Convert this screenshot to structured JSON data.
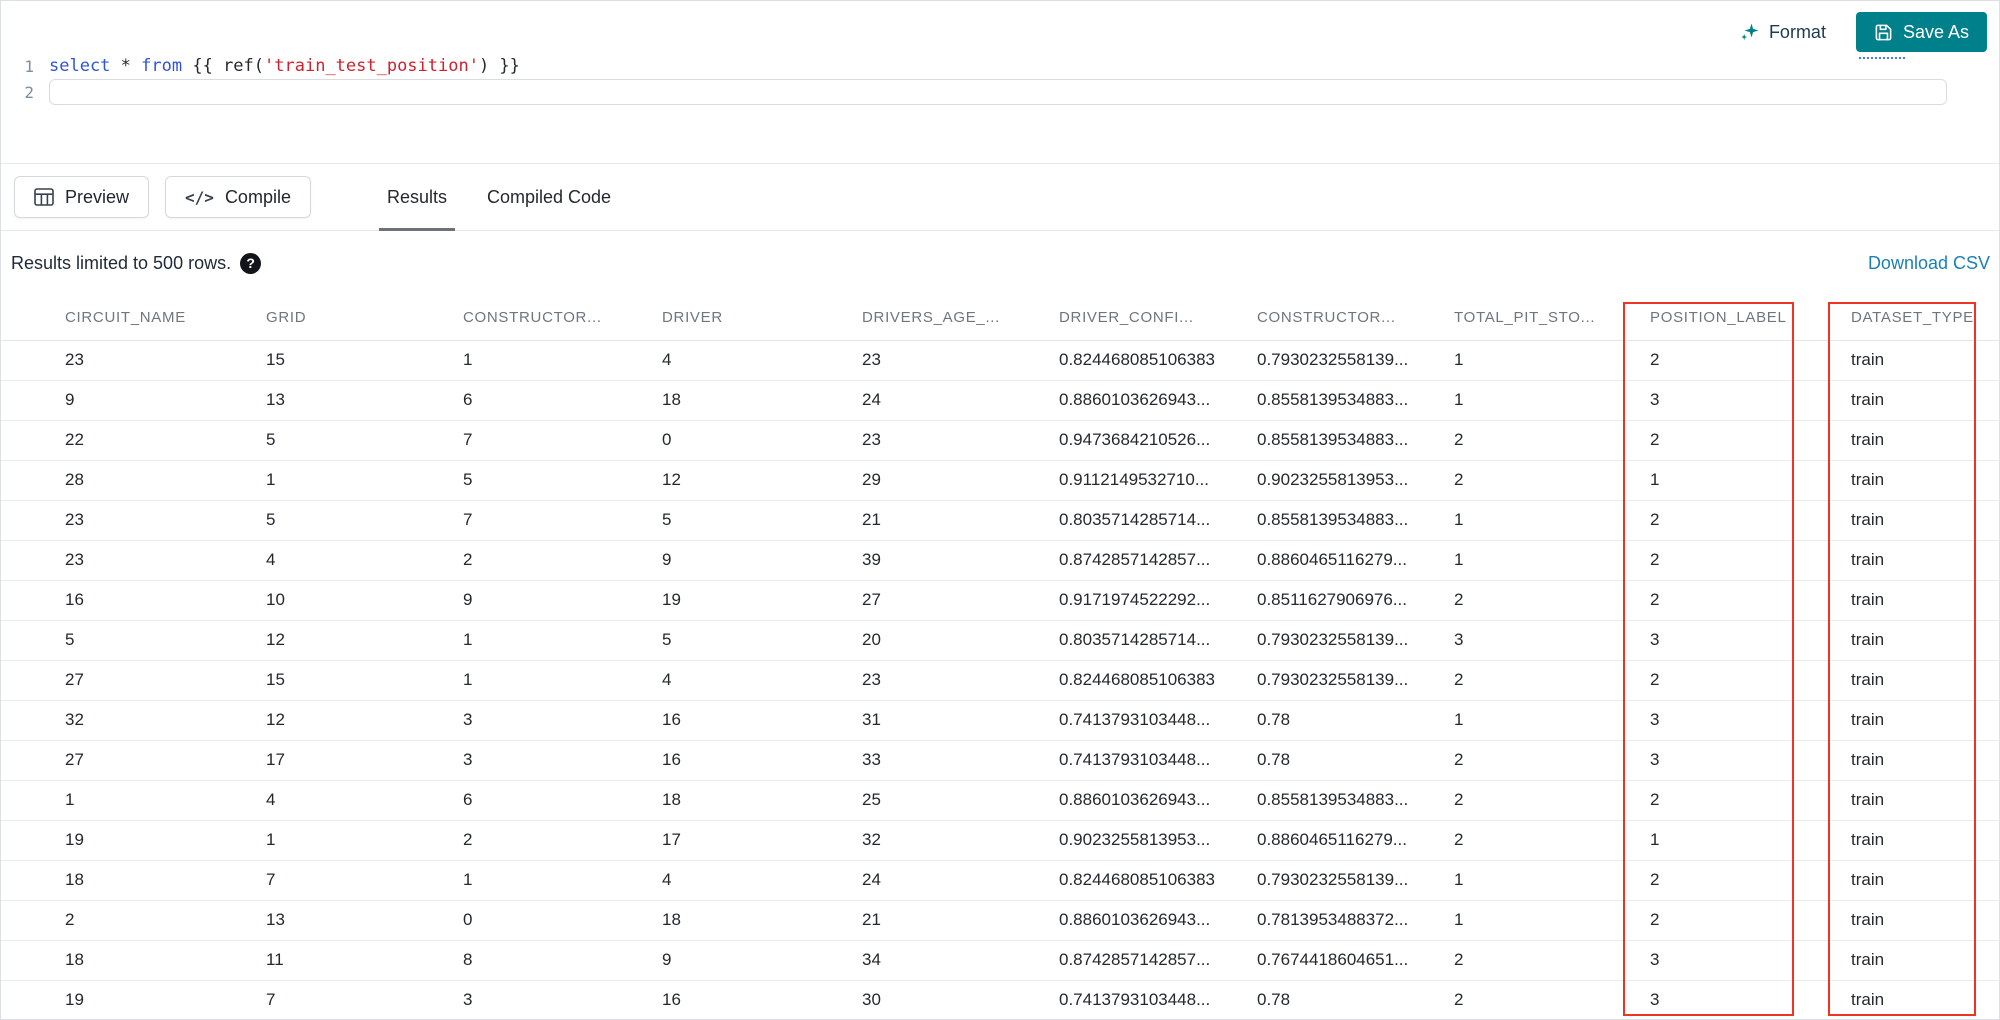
{
  "toolbar": {
    "format_label": "Format",
    "save_as_label": "Save As"
  },
  "editor": {
    "line_numbers": [
      "1",
      "2"
    ],
    "code_tokens": [
      {
        "t": "select",
        "c": "keyword"
      },
      {
        "t": " ",
        "c": "plain"
      },
      {
        "t": "*",
        "c": "operator"
      },
      {
        "t": " ",
        "c": "plain"
      },
      {
        "t": "from",
        "c": "keyword"
      },
      {
        "t": " {{ ref(",
        "c": "plain"
      },
      {
        "t": "'train_test_position'",
        "c": "string"
      },
      {
        "t": ") }}",
        "c": "plain"
      }
    ]
  },
  "actions": {
    "preview_label": "Preview",
    "compile_label": "Compile"
  },
  "tabs": [
    {
      "label": "Results",
      "active": true
    },
    {
      "label": "Compiled Code",
      "active": false
    }
  ],
  "results": {
    "limit_text": "Results limited to 500 rows.",
    "download_csv_label": "Download CSV"
  },
  "icons": {
    "compile_glyph": "</>",
    "help_glyph": "?"
  },
  "table": {
    "columns": [
      "CIRCUIT_NAME",
      "GRID",
      "CONSTRUCTOR...",
      "DRIVER",
      "DRIVERS_AGE_...",
      "DRIVER_CONFI...",
      "CONSTRUCTOR...",
      "TOTAL_PIT_STO...",
      "POSITION_LABEL",
      "DATASET_TYPE"
    ],
    "rows": [
      [
        "23",
        "15",
        "1",
        "4",
        "23",
        "0.824468085106383",
        "0.7930232558139...",
        "1",
        "2",
        "train"
      ],
      [
        "9",
        "13",
        "6",
        "18",
        "24",
        "0.8860103626943...",
        "0.8558139534883...",
        "1",
        "3",
        "train"
      ],
      [
        "22",
        "5",
        "7",
        "0",
        "23",
        "0.9473684210526...",
        "0.8558139534883...",
        "2",
        "2",
        "train"
      ],
      [
        "28",
        "1",
        "5",
        "12",
        "29",
        "0.9112149532710...",
        "0.9023255813953...",
        "2",
        "1",
        "train"
      ],
      [
        "23",
        "5",
        "7",
        "5",
        "21",
        "0.8035714285714...",
        "0.8558139534883...",
        "1",
        "2",
        "train"
      ],
      [
        "23",
        "4",
        "2",
        "9",
        "39",
        "0.8742857142857...",
        "0.8860465116279...",
        "1",
        "2",
        "train"
      ],
      [
        "16",
        "10",
        "9",
        "19",
        "27",
        "0.9171974522292...",
        "0.8511627906976...",
        "2",
        "2",
        "train"
      ],
      [
        "5",
        "12",
        "1",
        "5",
        "20",
        "0.8035714285714...",
        "0.7930232558139...",
        "3",
        "3",
        "train"
      ],
      [
        "27",
        "15",
        "1",
        "4",
        "23",
        "0.824468085106383",
        "0.7930232558139...",
        "2",
        "2",
        "train"
      ],
      [
        "32",
        "12",
        "3",
        "16",
        "31",
        "0.7413793103448...",
        "0.78",
        "1",
        "3",
        "train"
      ],
      [
        "27",
        "17",
        "3",
        "16",
        "33",
        "0.7413793103448...",
        "0.78",
        "2",
        "3",
        "train"
      ],
      [
        "1",
        "4",
        "6",
        "18",
        "25",
        "0.8860103626943...",
        "0.8558139534883...",
        "2",
        "2",
        "train"
      ],
      [
        "19",
        "1",
        "2",
        "17",
        "32",
        "0.9023255813953...",
        "0.8860465116279...",
        "2",
        "1",
        "train"
      ],
      [
        "18",
        "7",
        "1",
        "4",
        "24",
        "0.824468085106383",
        "0.7930232558139...",
        "1",
        "2",
        "train"
      ],
      [
        "2",
        "13",
        "0",
        "18",
        "21",
        "0.8860103626943...",
        "0.7813953488372...",
        "1",
        "2",
        "train"
      ],
      [
        "18",
        "11",
        "8",
        "9",
        "34",
        "0.8742857142857...",
        "0.7674418604651...",
        "2",
        "3",
        "train"
      ],
      [
        "19",
        "7",
        "3",
        "16",
        "30",
        "0.7413793103448...",
        "0.78",
        "2",
        "3",
        "train"
      ]
    ],
    "highlighted_columns": [
      "POSITION_LABEL",
      "DATASET_TYPE"
    ]
  },
  "colors": {
    "accent_teal": "#00808a",
    "link_blue": "#1c7fb5",
    "annotation_red": "#ee3524",
    "keyword_blue": "#2f55d4",
    "string_red": "#cf222e"
  }
}
